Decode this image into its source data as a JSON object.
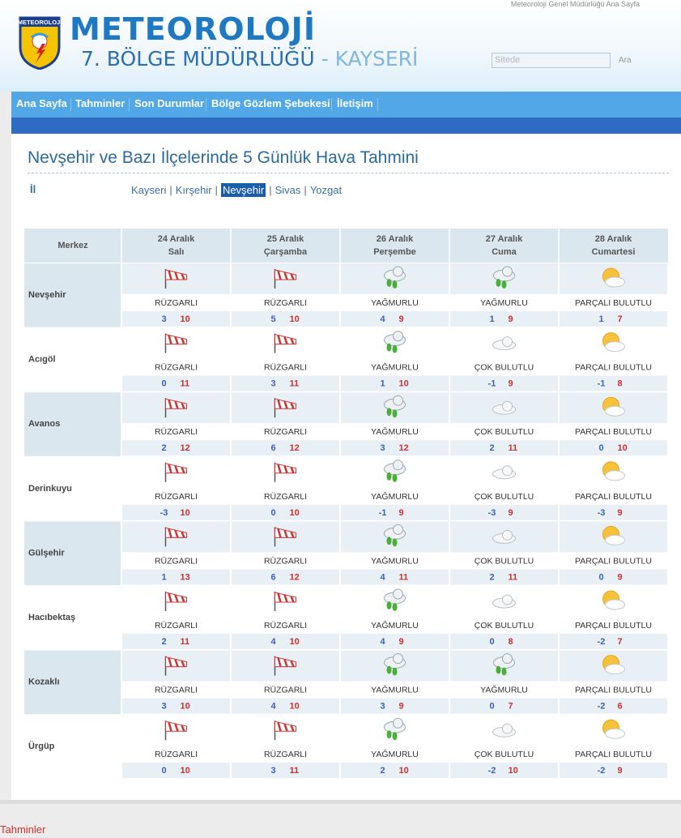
{
  "header": {
    "top_link": "Meteoroloji Genel Müdürlüğü Ana Sayfa",
    "logo_text": "METEOROLOJİ",
    "brand_title": "METEOROLOJİ",
    "brand_sub": "7. BÖLGE MÜDÜRLÜĞÜ",
    "brand_sub_sep": " - ",
    "brand_city": "KAYSERİ",
    "search_placeholder": "Sitede",
    "search_button": "Ara"
  },
  "nav": {
    "items": [
      "Ana Sayfa",
      "Tahminler",
      "Son Durumlar",
      "Bölge Gözlem Şebekesi",
      "İletişim"
    ]
  },
  "page": {
    "title": "Nevşehir ve Bazı İlçelerinde 5 Günlük Hava Tahmini",
    "il_label": "İl",
    "cities": [
      "Kayseri",
      "Kırşehir",
      "Nevşehir",
      "Sivas",
      "Yozgat"
    ],
    "active_city": "Nevşehir"
  },
  "table": {
    "corner_label": "Merkez",
    "days": [
      {
        "date": "24 Aralık",
        "weekday": "Salı"
      },
      {
        "date": "25 Aralık",
        "weekday": "Çarşamba"
      },
      {
        "date": "26 Aralık",
        "weekday": "Perşembe"
      },
      {
        "date": "27 Aralık",
        "weekday": "Cuma"
      },
      {
        "date": "28 Aralık",
        "weekday": "Cumartesi"
      }
    ],
    "rows": [
      {
        "name": "Nevşehir",
        "cells": [
          {
            "icon": "windsock-icon",
            "cond": "RÜZGARLI",
            "min": "3",
            "max": "10"
          },
          {
            "icon": "windsock-icon",
            "cond": "RÜZGARLI",
            "min": "5",
            "max": "10"
          },
          {
            "icon": "rain-cloud-icon",
            "cond": "YAĞMURLU",
            "min": "4",
            "max": "9"
          },
          {
            "icon": "rain-cloud-icon",
            "cond": "YAĞMURLU",
            "min": "1",
            "max": "9"
          },
          {
            "icon": "partly-cloudy-icon",
            "cond": "PARÇALI BULUTLU",
            "min": "1",
            "max": "7"
          }
        ]
      },
      {
        "name": "Acıgöl",
        "cells": [
          {
            "icon": "windsock-icon",
            "cond": "RÜZGARLI",
            "min": "0",
            "max": "11"
          },
          {
            "icon": "windsock-icon",
            "cond": "RÜZGARLI",
            "min": "3",
            "max": "11"
          },
          {
            "icon": "rain-cloud-icon",
            "cond": "YAĞMURLU",
            "min": "1",
            "max": "10"
          },
          {
            "icon": "cloudy-icon",
            "cond": "ÇOK BULUTLU",
            "min": "-1",
            "max": "9"
          },
          {
            "icon": "partly-cloudy-icon",
            "cond": "PARÇALI BULUTLU",
            "min": "-1",
            "max": "8"
          }
        ]
      },
      {
        "name": "Avanos",
        "cells": [
          {
            "icon": "windsock-icon",
            "cond": "RÜZGARLI",
            "min": "2",
            "max": "12"
          },
          {
            "icon": "windsock-icon",
            "cond": "RÜZGARLI",
            "min": "6",
            "max": "12"
          },
          {
            "icon": "rain-cloud-icon",
            "cond": "YAĞMURLU",
            "min": "3",
            "max": "12"
          },
          {
            "icon": "cloudy-icon",
            "cond": "ÇOK BULUTLU",
            "min": "2",
            "max": "11"
          },
          {
            "icon": "partly-cloudy-icon",
            "cond": "PARÇALI BULUTLU",
            "min": "0",
            "max": "10"
          }
        ]
      },
      {
        "name": "Derinkuyu",
        "cells": [
          {
            "icon": "windsock-icon",
            "cond": "RÜZGARLI",
            "min": "-3",
            "max": "10"
          },
          {
            "icon": "windsock-icon",
            "cond": "RÜZGARLI",
            "min": "0",
            "max": "10"
          },
          {
            "icon": "rain-cloud-icon",
            "cond": "YAĞMURLU",
            "min": "-1",
            "max": "9"
          },
          {
            "icon": "cloudy-icon",
            "cond": "ÇOK BULUTLU",
            "min": "-3",
            "max": "9"
          },
          {
            "icon": "partly-cloudy-icon",
            "cond": "PARÇALI BULUTLU",
            "min": "-3",
            "max": "9"
          }
        ]
      },
      {
        "name": "Gülşehir",
        "cells": [
          {
            "icon": "windsock-icon",
            "cond": "RÜZGARLI",
            "min": "1",
            "max": "13"
          },
          {
            "icon": "windsock-icon",
            "cond": "RÜZGARLI",
            "min": "6",
            "max": "12"
          },
          {
            "icon": "rain-cloud-icon",
            "cond": "YAĞMURLU",
            "min": "4",
            "max": "11"
          },
          {
            "icon": "cloudy-icon",
            "cond": "ÇOK BULUTLU",
            "min": "2",
            "max": "11"
          },
          {
            "icon": "partly-cloudy-icon",
            "cond": "PARÇALI BULUTLU",
            "min": "0",
            "max": "9"
          }
        ]
      },
      {
        "name": "Hacıbektaş",
        "cells": [
          {
            "icon": "windsock-icon",
            "cond": "RÜZGARLI",
            "min": "2",
            "max": "11"
          },
          {
            "icon": "windsock-icon",
            "cond": "RÜZGARLI",
            "min": "4",
            "max": "10"
          },
          {
            "icon": "rain-cloud-icon",
            "cond": "YAĞMURLU",
            "min": "4",
            "max": "9"
          },
          {
            "icon": "cloudy-icon",
            "cond": "ÇOK BULUTLU",
            "min": "0",
            "max": "8"
          },
          {
            "icon": "partly-cloudy-icon",
            "cond": "PARÇALI BULUTLU",
            "min": "-2",
            "max": "7"
          }
        ]
      },
      {
        "name": "Kozaklı",
        "cells": [
          {
            "icon": "windsock-icon",
            "cond": "RÜZGARLI",
            "min": "3",
            "max": "10"
          },
          {
            "icon": "windsock-icon",
            "cond": "RÜZGARLI",
            "min": "4",
            "max": "10"
          },
          {
            "icon": "rain-cloud-icon",
            "cond": "YAĞMURLU",
            "min": "3",
            "max": "9"
          },
          {
            "icon": "rain-cloud-icon",
            "cond": "YAĞMURLU",
            "min": "0",
            "max": "7"
          },
          {
            "icon": "partly-cloudy-icon",
            "cond": "PARÇALI BULUTLU",
            "min": "-2",
            "max": "6"
          }
        ]
      },
      {
        "name": "Ürgüp",
        "cells": [
          {
            "icon": "windsock-icon",
            "cond": "RÜZGARLI",
            "min": "0",
            "max": "10"
          },
          {
            "icon": "windsock-icon",
            "cond": "RÜZGARLI",
            "min": "3",
            "max": "11"
          },
          {
            "icon": "rain-cloud-icon",
            "cond": "YAĞMURLU",
            "min": "2",
            "max": "10"
          },
          {
            "icon": "cloudy-icon",
            "cond": "ÇOK BULUTLU",
            "min": "-2",
            "max": "10"
          },
          {
            "icon": "partly-cloudy-icon",
            "cond": "PARÇALI BULUTLU",
            "min": "-2",
            "max": "9"
          }
        ]
      }
    ]
  },
  "footer": {
    "label": "Tahminler"
  },
  "colors": {
    "brand_blue": "#1e78c2",
    "nav_blue": "#52a8e6",
    "nav_dark": "#2e6bc2",
    "min_temp": "#3b62b4",
    "max_temp": "#c73232",
    "header_cell": "#dbe7ef",
    "row_label_alt": "#dbe7ef"
  }
}
